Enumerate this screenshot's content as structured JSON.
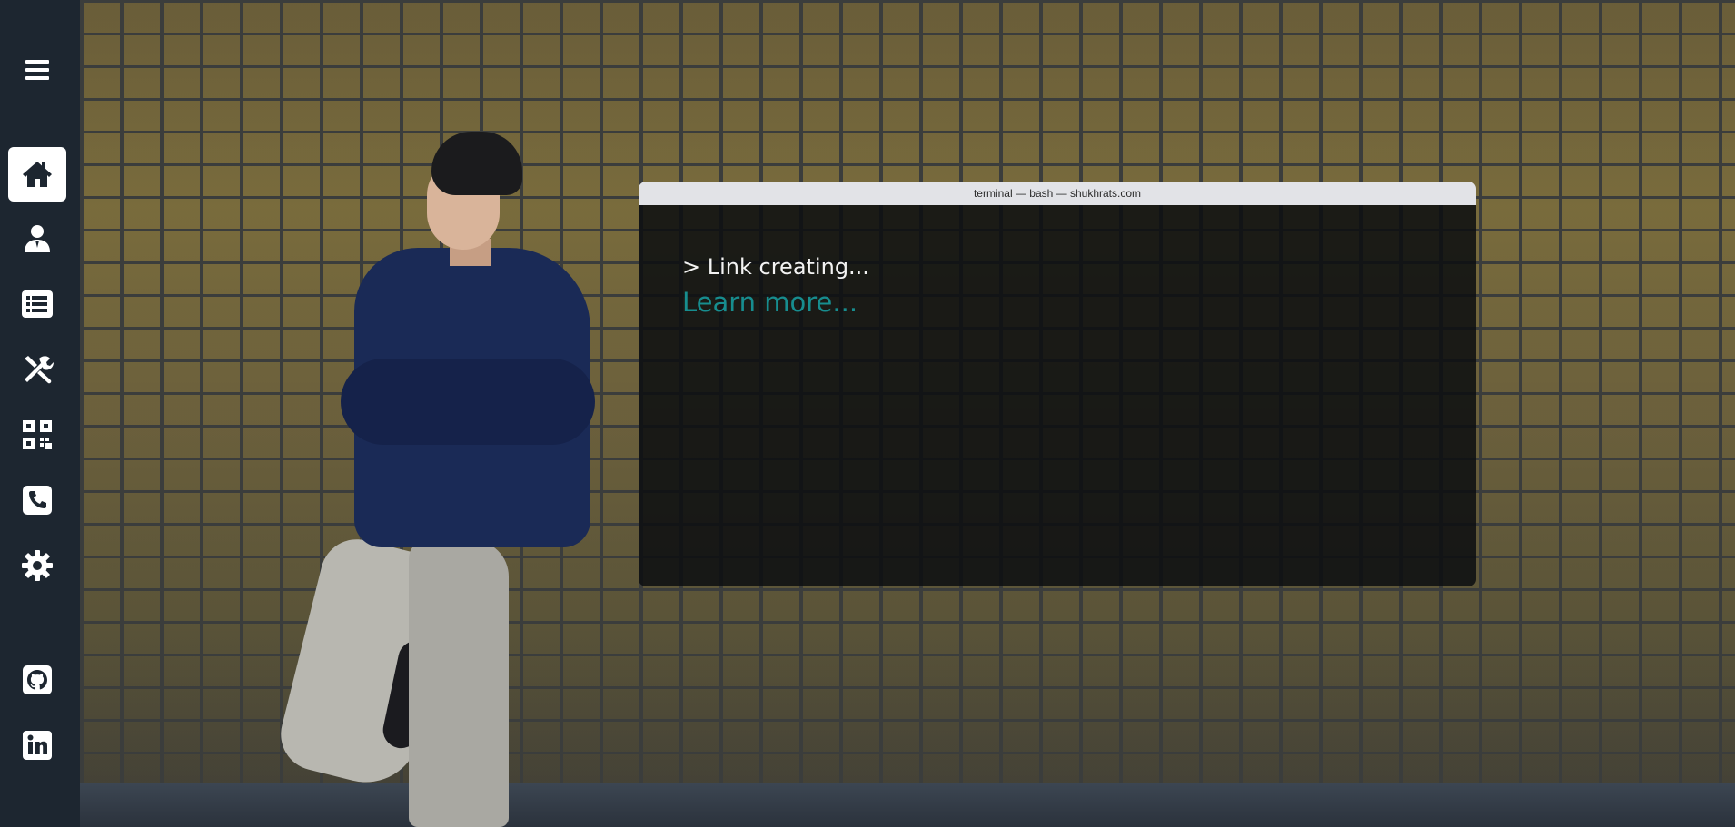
{
  "sidebar": {
    "items": [
      {
        "icon": "menu-icon",
        "active": false
      },
      {
        "icon": "home-icon",
        "active": true
      },
      {
        "icon": "user-icon",
        "active": false
      },
      {
        "icon": "list-icon",
        "active": false
      },
      {
        "icon": "tools-icon",
        "active": false
      },
      {
        "icon": "qrcode-icon",
        "active": false
      },
      {
        "icon": "phone-icon",
        "active": false
      },
      {
        "icon": "gear-icon",
        "active": false
      },
      {
        "icon": "github-icon",
        "active": false
      },
      {
        "icon": "linkedin-icon",
        "active": false
      }
    ]
  },
  "terminal": {
    "title": "terminal — bash — shukhrats.com",
    "line": "> Link creating...",
    "link_label": "Learn more..."
  },
  "colors": {
    "sidebar_bg": "#1d2630",
    "active_item_bg": "#ffffff",
    "link": "#178d8f",
    "terminal_titlebar": "#e2e3e7"
  }
}
